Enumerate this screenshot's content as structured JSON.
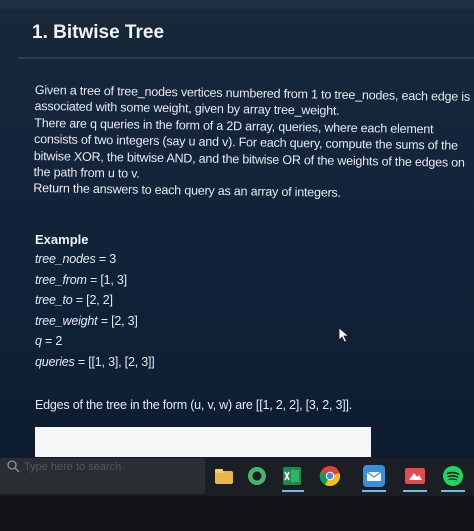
{
  "header": {
    "title": "1. Bitwise Tree"
  },
  "problem": {
    "paragraphs": [
      "Given a tree of tree_nodes vertices numbered from 1 to tree_nodes, each edge is associated with some weight, given by array tree_weight.",
      "There are q queries in the form of a 2D array, queries, where each element consists of two integers (say u and v). For each query, compute the sums of the bitwise XOR, the bitwise AND, and the bitwise OR of the weights of the edges on the path from u to v.",
      "Return the answers to each query as an array of integers."
    ]
  },
  "example": {
    "title": "Example",
    "lines": [
      {
        "key": "tree_nodes",
        "value": " = 3"
      },
      {
        "key": "tree_from",
        "value": " = [1, 3]"
      },
      {
        "key": "tree_to",
        "value": " = [2, 2]"
      },
      {
        "key": "tree_weight",
        "value": " = [2, 3]"
      },
      {
        "key": "q",
        "value": " = 2"
      },
      {
        "key": "queries",
        "value": " = [[1, 3], [2, 3]]"
      }
    ],
    "edges_text": "Edges of the tree in the form (u, v, w) are [[1, 2, 2], [3, 2, 3]]."
  },
  "taskbar": {
    "search_placeholder": "Type here to search",
    "icons": [
      "explorer-icon",
      "excel-icon",
      "chrome-icon",
      "edge-icon",
      "mail-icon",
      "spotify-icon"
    ]
  },
  "colors": {
    "background": "#13233a",
    "text": "#e6eaf0",
    "taskbar": "#1b1f24",
    "accent": "#76b9ed"
  }
}
